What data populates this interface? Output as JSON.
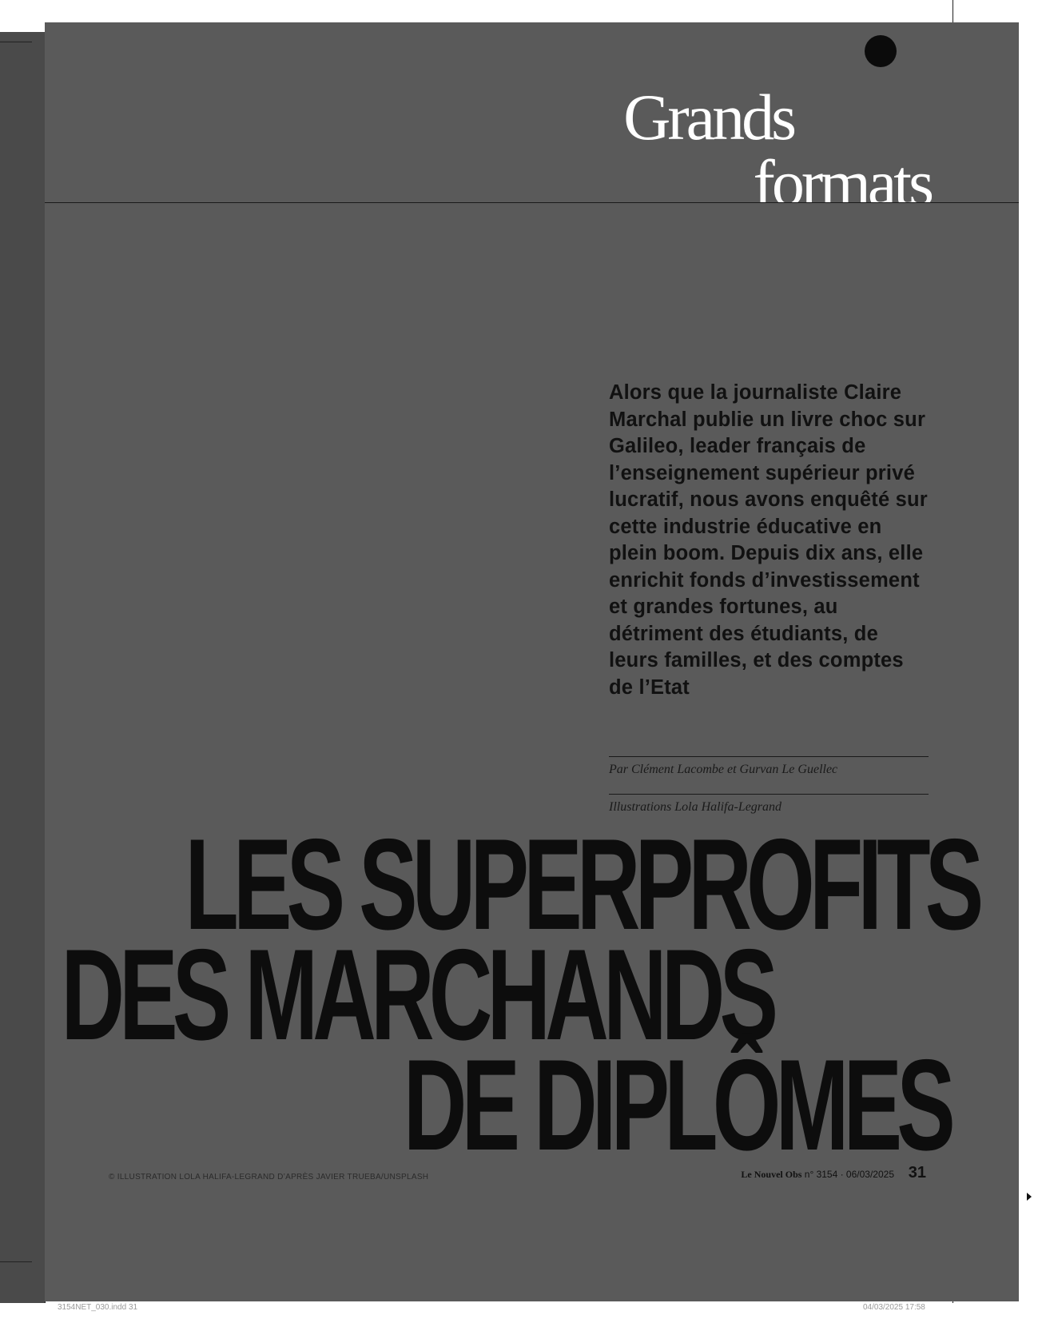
{
  "section": {
    "line1": "Grands",
    "line2": "formats"
  },
  "lede": "Alors que la journaliste Claire Marchal publie un livre choc sur Galileo, leader français de l’enseignement supérieur privé lucratif, nous avons enquêté sur cette industrie éducative en plein boom. Depuis dix ans, elle enrichit fonds d’investissement et grandes fortunes, au détriment des étudiants, de leurs familles, et des comptes de l’Etat",
  "byline": "Par Clément Lacombe et Gurvan Le Guellec",
  "illustrations": "Illustrations Lola Halifa-Legrand",
  "headline": {
    "line1": "LES SUPERPROFITS",
    "line2": "DES MARCHANDS",
    "line3": "DE DIPLÔMES"
  },
  "footer": {
    "photo_credit": "© ILLUSTRATION LOLA HALIFA-LEGRAND D’APRÈS JAVIER TRUEBA/UNSPLASH",
    "brand": "Le Nouvel Obs",
    "issue": "n° 3154 · 06/03/2025",
    "page_number": "31"
  },
  "slug": {
    "left": "3154NET_030.indd   31",
    "right": "04/03/2025   17:58"
  },
  "colors": {
    "page": "#5a5a5a",
    "ink": "#0d0d0d",
    "section_title": "#ffffff"
  }
}
